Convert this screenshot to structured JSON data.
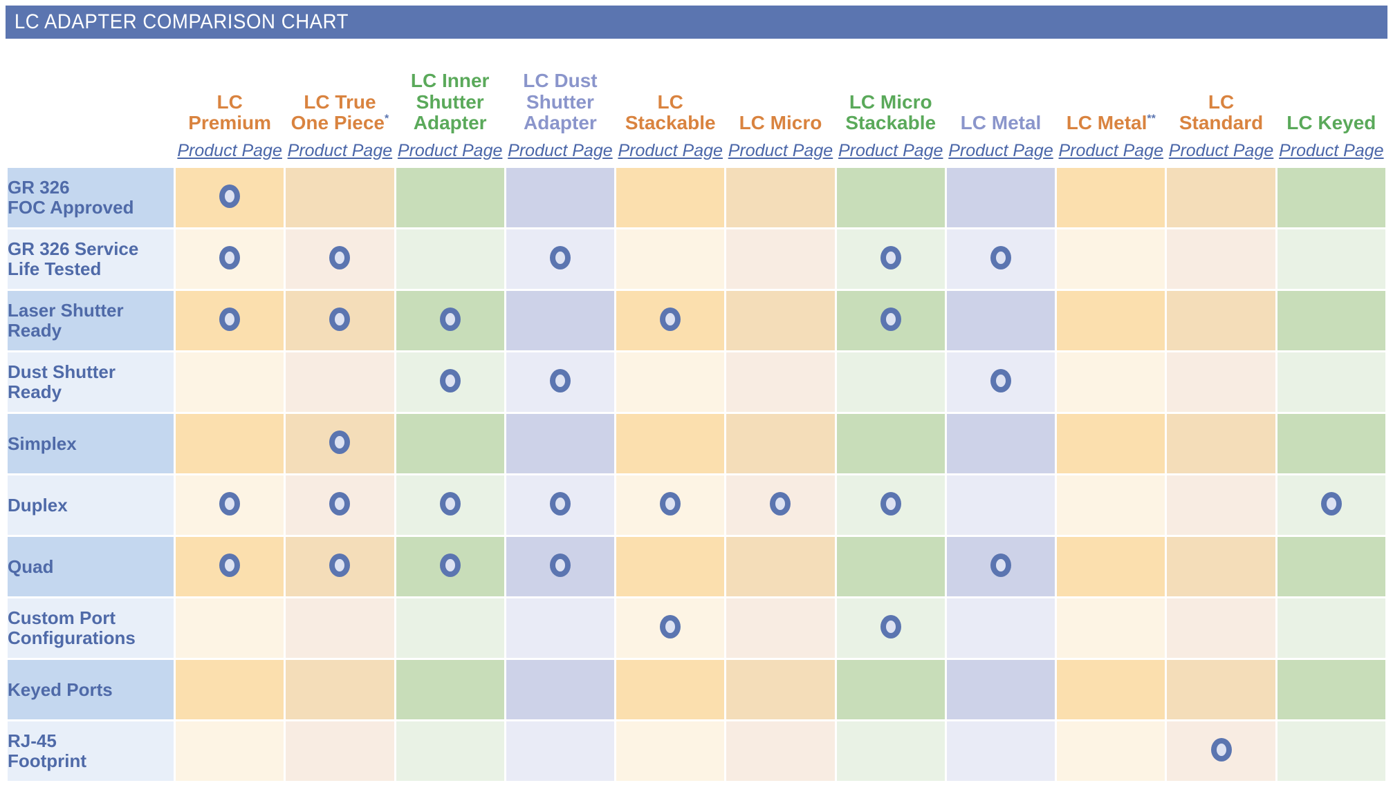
{
  "header": {
    "title": "LC ADAPTER COMPARISON CHART",
    "bar_color": "#5b75b0"
  },
  "columns": [
    {
      "name": "LC\nPremium",
      "color": "#d9833f",
      "tint": "orange-light",
      "superscript": "",
      "link": "Product Page"
    },
    {
      "name": "LC True\nOne Piece",
      "color": "#d9833f",
      "tint": "orange-dark",
      "superscript": "*",
      "link": "Product Page"
    },
    {
      "name": "LC Inner\nShutter\nAdapter",
      "color": "#5aa95a",
      "tint": "green",
      "superscript": "",
      "link": "Product Page"
    },
    {
      "name": "LC Dust\nShutter\nAdapter",
      "color": "#8a95cb",
      "tint": "purple",
      "superscript": "",
      "link": "Product Page"
    },
    {
      "name": "LC\nStackable",
      "color": "#d9833f",
      "tint": "orange-light",
      "superscript": "",
      "link": "Product Page"
    },
    {
      "name": "LC Micro",
      "color": "#d9833f",
      "tint": "orange-dark",
      "superscript": "",
      "link": "Product Page"
    },
    {
      "name": "LC Micro\nStackable",
      "color": "#5aa95a",
      "tint": "green",
      "superscript": "",
      "link": "Product Page"
    },
    {
      "name": "LC Metal",
      "color": "#8a95cb",
      "tint": "purple",
      "superscript": "",
      "link": "Product Page"
    },
    {
      "name": "LC Metal",
      "color": "#d9833f",
      "tint": "orange-light",
      "superscript": "**",
      "link": "Product Page"
    },
    {
      "name": "LC\nStandard",
      "color": "#d9833f",
      "tint": "orange-dark",
      "superscript": "",
      "link": "Product Page"
    },
    {
      "name": "LC Keyed",
      "color": "#5aa95a",
      "tint": "green",
      "superscript": "",
      "link": "Product Page"
    }
  ],
  "rows": [
    {
      "label": "GR 326\nFOC Approved",
      "shade": "dark",
      "marks": [
        1,
        0,
        0,
        0,
        0,
        0,
        0,
        0,
        0,
        0,
        0
      ]
    },
    {
      "label": "GR 326 Service\nLife Tested",
      "shade": "light",
      "marks": [
        1,
        1,
        0,
        1,
        0,
        0,
        1,
        1,
        0,
        0,
        0
      ]
    },
    {
      "label": "Laser Shutter\nReady",
      "shade": "dark",
      "marks": [
        1,
        1,
        1,
        0,
        1,
        0,
        1,
        0,
        0,
        0,
        0
      ]
    },
    {
      "label": "Dust Shutter\nReady",
      "shade": "light",
      "marks": [
        0,
        0,
        1,
        1,
        0,
        0,
        0,
        1,
        0,
        0,
        0
      ]
    },
    {
      "label": "Simplex",
      "shade": "dark",
      "marks": [
        0,
        1,
        0,
        0,
        0,
        0,
        0,
        0,
        0,
        0,
        0
      ]
    },
    {
      "label": "Duplex",
      "shade": "light",
      "marks": [
        1,
        1,
        1,
        1,
        1,
        1,
        1,
        0,
        0,
        0,
        1
      ]
    },
    {
      "label": "Quad",
      "shade": "dark",
      "marks": [
        1,
        1,
        1,
        1,
        0,
        0,
        0,
        1,
        0,
        0,
        0
      ]
    },
    {
      "label": "Custom Port\nConfigurations",
      "shade": "light",
      "marks": [
        0,
        0,
        0,
        0,
        1,
        0,
        1,
        0,
        0,
        0,
        0
      ]
    },
    {
      "label": "Keyed Ports",
      "shade": "dark",
      "marks": [
        0,
        0,
        0,
        0,
        0,
        0,
        0,
        0,
        0,
        0,
        0
      ]
    },
    {
      "label": "RJ-45\nFootprint",
      "shade": "light",
      "marks": [
        0,
        0,
        0,
        0,
        0,
        0,
        0,
        0,
        0,
        1,
        0
      ]
    }
  ],
  "marker": {
    "icon": "filled-ring-icon",
    "ring_color": "#5b75b0",
    "fill_color": "#dde2f2"
  },
  "palette": {
    "header_blue": "#5b75b0",
    "label_dark": "#c4d7ef",
    "label_light": "#e8eff9",
    "label_text": "#4f6aa8",
    "orange_light_dark": "#fbdfae",
    "orange_light_light": "#fdf4e4",
    "orange_dark_dark": "#f4ddb9",
    "orange_dark_light": "#f8ece2",
    "green_dark": "#c8ddb9",
    "green_light": "#e9f2e5",
    "purple_dark": "#cdd2e8",
    "purple_light": "#e9ebf6",
    "link_blue": "#4a66a8"
  }
}
